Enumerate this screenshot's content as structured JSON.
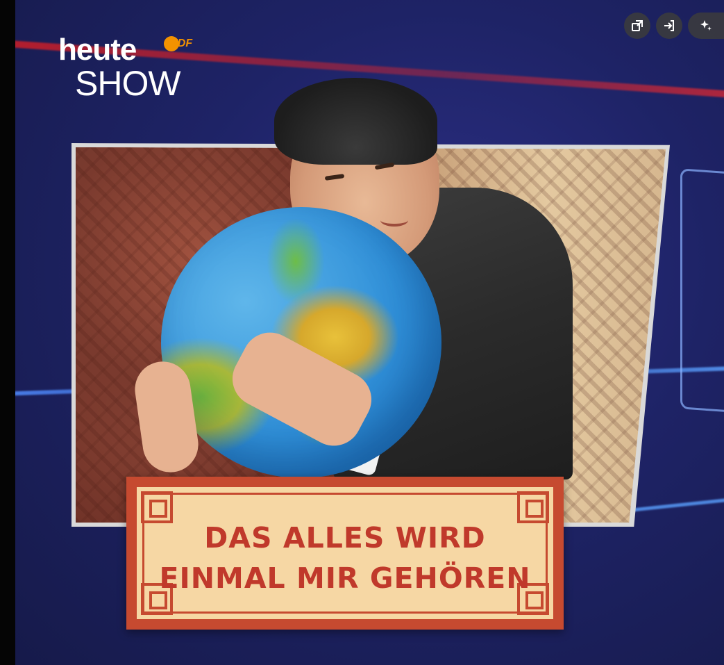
{
  "toolbar": {
    "buttons": [
      {
        "name": "open-in-new-window",
        "icon": "popout-icon"
      },
      {
        "name": "enter-icon",
        "icon": "login-icon"
      },
      {
        "name": "ai-sparkle",
        "icon": "sparkle-icon"
      }
    ]
  },
  "logo": {
    "line1": "heute",
    "line2": "SHOW",
    "badge": "ZDF"
  },
  "banner": {
    "line1": "DAS ALLES WIRD",
    "line2": "EINMAL MIR GEHÖREN"
  },
  "colors": {
    "brand_orange": "#f39200",
    "banner_red": "#c64a30",
    "banner_cream": "#f6d7a4",
    "stage_blue": "#1e2366"
  }
}
